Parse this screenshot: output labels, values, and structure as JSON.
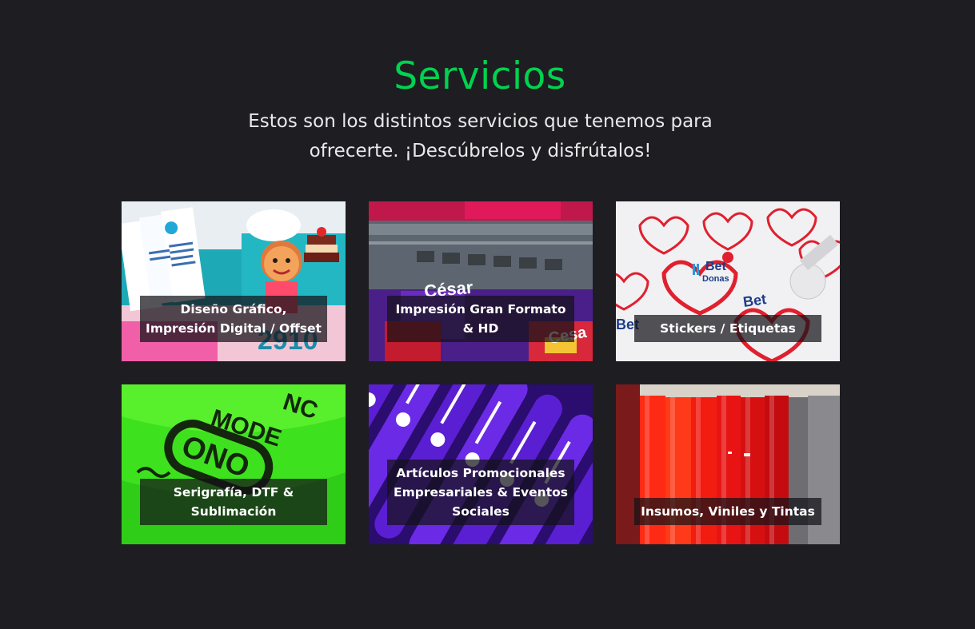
{
  "section": {
    "title": "Servicios",
    "subtitle": "Estos son los distintos servicios que tenemos para ofrecerte. ¡Descúbrelos y disfrútalos!"
  },
  "colors": {
    "background": "#1e1d22",
    "accent": "#00d34f",
    "subtitle": "#e9e9ea"
  },
  "services": [
    {
      "label": "Diseño Gráfico, Impresión Digital / Offset",
      "image": "flyers-chef-illustration"
    },
    {
      "label": "Impresión Gran Formato & HD",
      "image": "large-format-printer"
    },
    {
      "label": "Stickers / Etiquetas",
      "image": "heart-stickers"
    },
    {
      "label": "Serigrafía, DTF & Sublimación",
      "image": "green-screenprint-shirt"
    },
    {
      "label": "Artículos Promocionales Empresariales & Eventos Sociales",
      "image": "purple-promo-pens"
    },
    {
      "label": "Insumos, Viniles y Tintas",
      "image": "red-vinyl-rolls"
    }
  ]
}
